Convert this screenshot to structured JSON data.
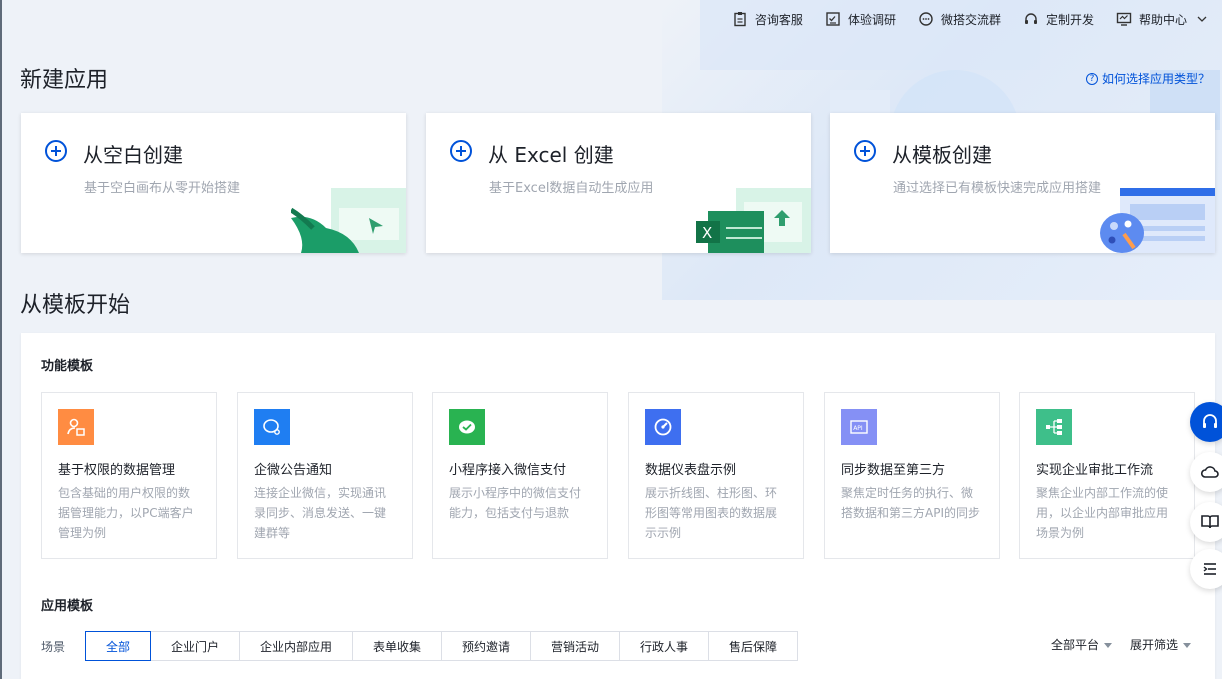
{
  "topbar": {
    "items": [
      {
        "label": "咨询客服",
        "icon": "clipboard-icon"
      },
      {
        "label": "体验调研",
        "icon": "survey-icon"
      },
      {
        "label": "微搭交流群",
        "icon": "chat-icon"
      },
      {
        "label": "定制开发",
        "icon": "headset-icon"
      },
      {
        "label": "帮助中心",
        "icon": "monitor-icon"
      }
    ]
  },
  "new_app": {
    "title": "新建应用",
    "help_link": "如何选择应用类型？",
    "cards": [
      {
        "title": "从空白创建",
        "desc": "基于空白画布从零开始搭建"
      },
      {
        "title": "从 Excel 创建",
        "desc": "基于Excel数据自动生成应用"
      },
      {
        "title": "从模板创建",
        "desc": "通过选择已有模板快速完成应用搭建"
      }
    ]
  },
  "templates": {
    "title": "从模板开始",
    "feature_title": "功能模板",
    "feature_cards": [
      {
        "name": "基于权限的数据管理",
        "desc": "包含基础的用户权限的数据管理能力，以PC端客户管理为例",
        "color": "#ff8c42"
      },
      {
        "name": "企微公告通知",
        "desc": "连接企业微信，实现通讯录同步、消息发送、一键建群等",
        "color": "#1f7ef2"
      },
      {
        "name": "小程序接入微信支付",
        "desc": "展示小程序中的微信支付能力，包括支付与退款",
        "color": "#29b351"
      },
      {
        "name": "数据仪表盘示例",
        "desc": "展示折线图、柱形图、环形图等常用图表的数据展示示例",
        "color": "#3e6ff0"
      },
      {
        "name": "同步数据至第三方",
        "desc": "聚焦定时任务的执行、微搭数据和第三方API的同步",
        "color": "#8590f5"
      },
      {
        "name": "实现企业审批工作流",
        "desc": "聚焦企业内部工作流的使用，以企业内部审批应用场景为例",
        "color": "#3ebf8a"
      }
    ],
    "app_title": "应用模板",
    "scene_label": "场景",
    "scenes": [
      "全部",
      "企业门户",
      "企业内部应用",
      "表单收集",
      "预约邀请",
      "营销活动",
      "行政人事",
      "售后保障"
    ],
    "platform_filter": "全部平台",
    "expand_filter": "展开筛选"
  },
  "colors": {
    "accent": "#0052d9",
    "illus_green": "#1fb37a"
  }
}
